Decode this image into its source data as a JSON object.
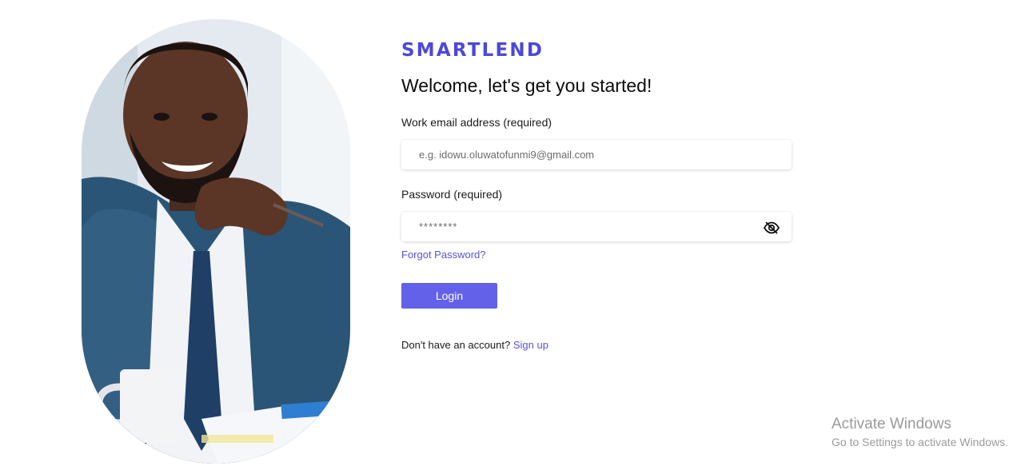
{
  "brand": {
    "name": "SMARTLEND",
    "color": "#4b47dd"
  },
  "welcome": {
    "heading": "Welcome, let's get you started!"
  },
  "form": {
    "email": {
      "label": "Work email address (required)",
      "placeholder": "e.g. idowu.oluwatofunmi9@gmail.com",
      "value": ""
    },
    "password": {
      "label": "Password (required)",
      "placeholder": "********",
      "value": "",
      "toggle_icon": "eye-off-icon"
    },
    "forgot_password_link": "Forgot Password?",
    "login_button": "Login",
    "signup_prompt": "Don't have an account?",
    "signup_link": "Sign up"
  },
  "colors": {
    "accent": "#6360ea",
    "link": "#5653e0"
  },
  "hero_image": {
    "description_icon": "person-photo"
  },
  "watermark": {
    "title": "Activate Windows",
    "subtitle": "Go to Settings to activate Windows."
  }
}
